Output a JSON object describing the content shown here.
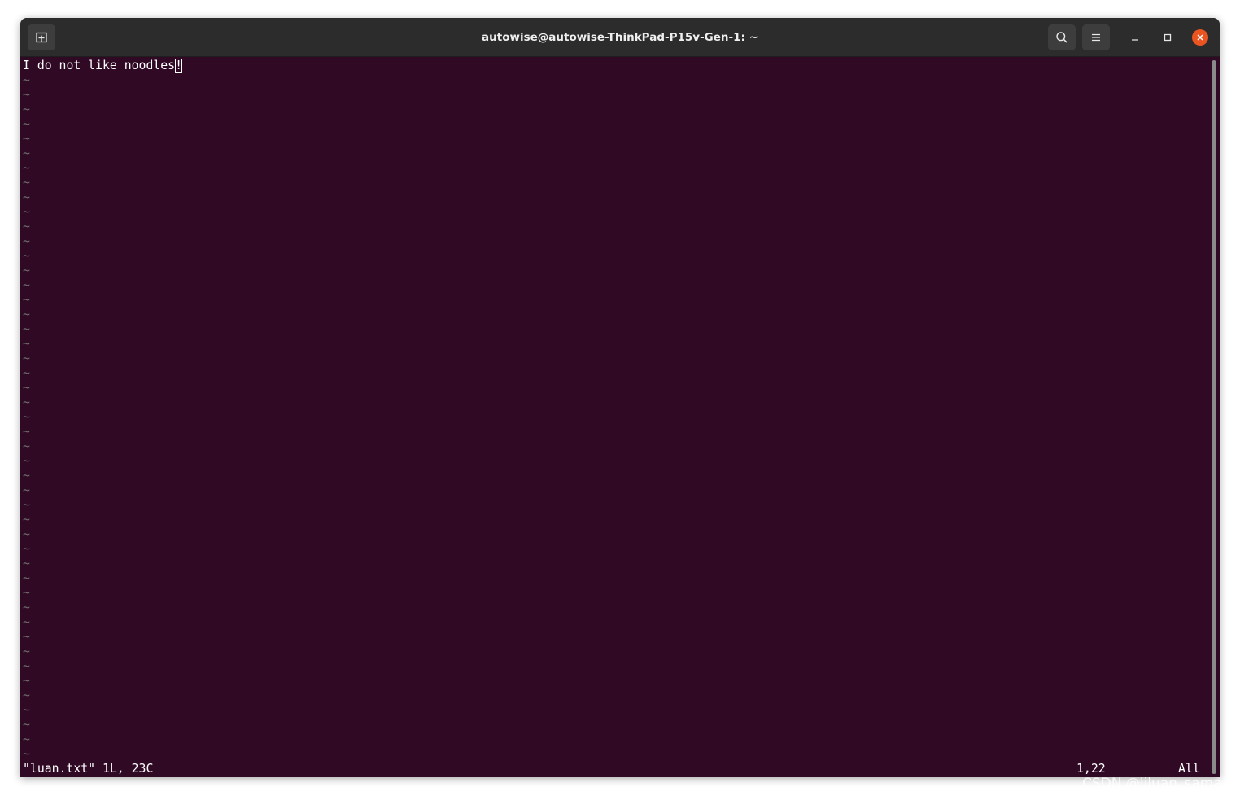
{
  "window": {
    "title": "autowise@autowise-ThinkPad-P15v-Gen-1: ~"
  },
  "titlebar": {
    "new_tab_icon": "new-tab-icon",
    "search_icon": "search-icon",
    "menu_icon": "hamburger-menu-icon",
    "minimize_icon": "minimize-icon",
    "maximize_icon": "maximize-icon",
    "close_icon": "close-icon"
  },
  "editor": {
    "text_before_cursor": "I do not like noodles",
    "cursor_char": "!",
    "empty_line_marker": "~",
    "empty_line_count": 47
  },
  "status": {
    "file_info": "\"luan.txt\" 1L, 23C",
    "cursor_position": "1,22",
    "scroll_position": "All"
  },
  "watermark": {
    "text": "CSDN @liluan_sama"
  },
  "colors": {
    "terminal_bg": "#300a24",
    "titlebar_bg": "#2c2c2c",
    "close_button": "#e95420",
    "text": "#ffffff",
    "tilde": "#6d6d6d"
  }
}
